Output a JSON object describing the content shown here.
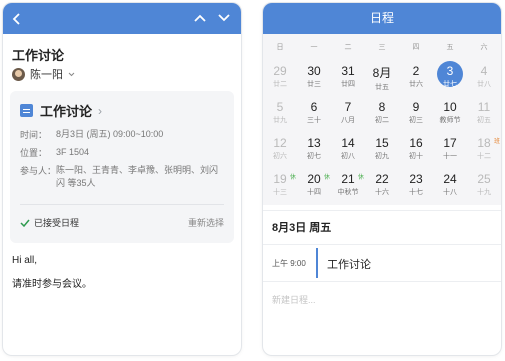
{
  "left": {
    "title": "工作讨论",
    "organizer": "陈一阳",
    "card": {
      "title": "工作讨论",
      "time_key": "时间：",
      "time_val": "8月3日 (周五) 09:00~10:00",
      "place_key": "位置：",
      "place_val": "3F 1504",
      "people_key": "参与人：",
      "people_val": "陈一阳、王青青、李卓豫、张明明、刘闪闪 等35人",
      "accepted": "已接受日程",
      "reselect": "重新选择"
    },
    "msg1": "Hi all,",
    "msg2": "请准时参与会议。"
  },
  "right": {
    "header": "日程",
    "weekdays": [
      "日",
      "一",
      "二",
      "三",
      "四",
      "五",
      "六"
    ],
    "weeks": [
      [
        {
          "n": "29",
          "l": "廿二",
          "dim": true
        },
        {
          "n": "30",
          "l": "廿三"
        },
        {
          "n": "31",
          "l": "廿四"
        },
        {
          "n": "8月",
          "l": "廿五"
        },
        {
          "n": "2",
          "l": "廿六"
        },
        {
          "n": "3",
          "l": "廿七",
          "sel": true
        },
        {
          "n": "4",
          "l": "廿八",
          "dim": true
        }
      ],
      [
        {
          "n": "5",
          "l": "廿九",
          "dim": true
        },
        {
          "n": "6",
          "l": "三十"
        },
        {
          "n": "7",
          "l": "八月"
        },
        {
          "n": "8",
          "l": "初二"
        },
        {
          "n": "9",
          "l": "初三"
        },
        {
          "n": "10",
          "l": "教师节"
        },
        {
          "n": "11",
          "l": "初五",
          "dim": true
        }
      ],
      [
        {
          "n": "12",
          "l": "初六",
          "dim": true
        },
        {
          "n": "13",
          "l": "初七"
        },
        {
          "n": "14",
          "l": "初八"
        },
        {
          "n": "15",
          "l": "初九"
        },
        {
          "n": "16",
          "l": "初十"
        },
        {
          "n": "17",
          "l": "十一"
        },
        {
          "n": "18",
          "l": "十二",
          "dim": true,
          "tag": "班",
          "tagType": "work"
        }
      ],
      [
        {
          "n": "19",
          "l": "十三",
          "dim": true,
          "tag": "休",
          "tagType": "rest"
        },
        {
          "n": "20",
          "l": "十四",
          "tag": "休",
          "tagType": "rest"
        },
        {
          "n": "21",
          "l": "中秋节",
          "tag": "休",
          "tagType": "rest"
        },
        {
          "n": "22",
          "l": "十六"
        },
        {
          "n": "23",
          "l": "十七"
        },
        {
          "n": "24",
          "l": "十八"
        },
        {
          "n": "25",
          "l": "十九",
          "dim": true
        }
      ]
    ],
    "date_label": "8月3日 周五",
    "event_time": "上午 9:00",
    "event_name": "工作讨论",
    "new_schedule": "新建日程..."
  }
}
